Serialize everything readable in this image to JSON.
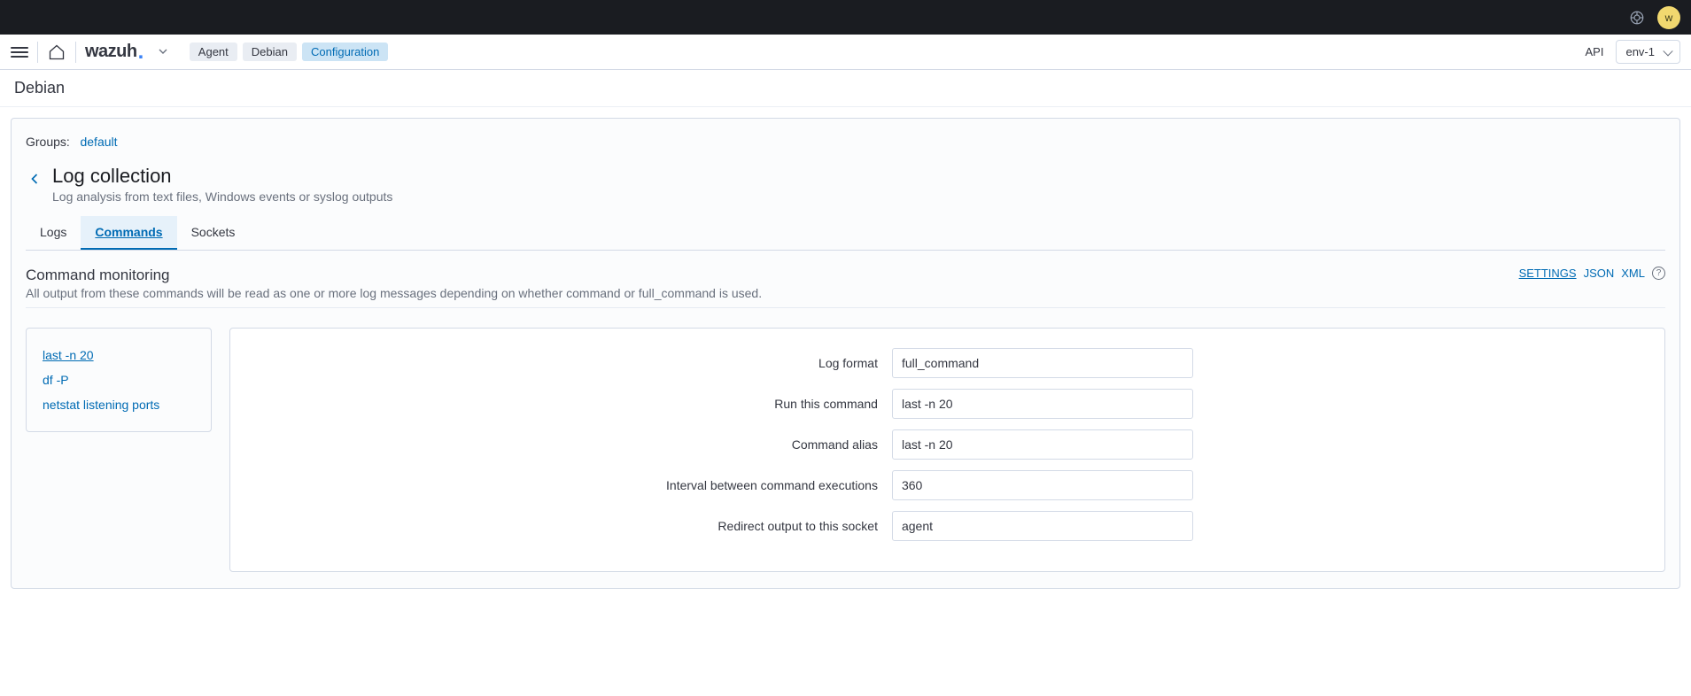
{
  "topbar": {
    "avatar_letter": "w"
  },
  "header": {
    "logo_text": "wazuh",
    "breadcrumbs": [
      {
        "label": "Agent",
        "active": false
      },
      {
        "label": "Debian",
        "active": false
      },
      {
        "label": "Configuration",
        "active": true
      }
    ],
    "api_label": "API",
    "env_label": "env-1"
  },
  "page_title": "Debian",
  "panel": {
    "groups_label": "Groups:",
    "groups_value": "default",
    "section_title": "Log collection",
    "section_subtitle": "Log analysis from text files, Windows events or syslog outputs",
    "tabs": [
      {
        "label": "Logs",
        "active": false
      },
      {
        "label": "Commands",
        "active": true
      },
      {
        "label": "Sockets",
        "active": false
      }
    ],
    "subsection_title": "Command monitoring",
    "subsection_desc": "All output from these commands will be read as one or more log messages depending on whether command or full_command is used.",
    "actions": {
      "settings": "SETTINGS",
      "json": "JSON",
      "xml": "XML"
    },
    "cmd_list": [
      {
        "label": "last -n 20",
        "active": true
      },
      {
        "label": "df -P",
        "active": false
      },
      {
        "label": "netstat listening ports",
        "active": false
      }
    ],
    "form": [
      {
        "label": "Log format",
        "value": "full_command"
      },
      {
        "label": "Run this command",
        "value": "last -n 20"
      },
      {
        "label": "Command alias",
        "value": "last -n 20"
      },
      {
        "label": "Interval between command executions",
        "value": "360"
      },
      {
        "label": "Redirect output to this socket",
        "value": "agent"
      }
    ]
  }
}
